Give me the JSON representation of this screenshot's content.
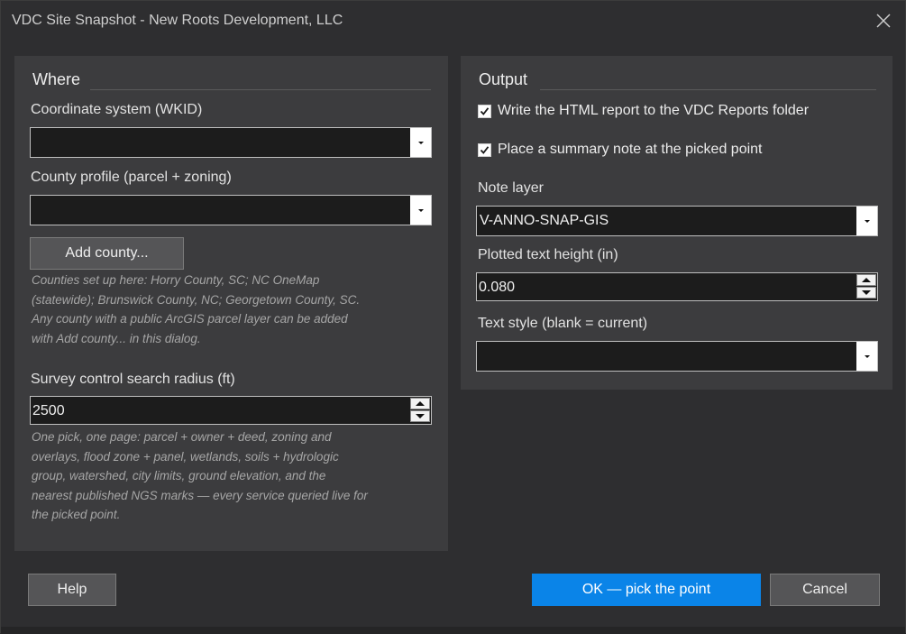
{
  "window": {
    "title": "VDC Site Snapshot - New Roots Development, LLC",
    "close_icon": "close-icon"
  },
  "where": {
    "title": "Where",
    "coordinate_label": "Coordinate system (WKID)",
    "coordinate_value": "",
    "county_label": "County profile (parcel + zoning)",
    "county_value": "",
    "add_county_label": "Add county...",
    "counties_hint": [
      "Counties set up here: Horry County, SC; NC OneMap",
      "(statewide); Brunswick County, NC; Georgetown County, SC.",
      "Any county with a public ArcGIS parcel layer can be added",
      "with Add county... in this dialog."
    ],
    "radius_label": "Survey control search radius (ft)",
    "radius_value": "2500",
    "pick_hint": [
      "One pick, one page: parcel + owner + deed, zoning and",
      "overlays, flood zone + panel, wetlands, soils + hydrologic",
      "group, watershed, city limits, ground elevation, and the",
      "nearest published NGS marks — every service queried live for",
      "the picked point."
    ]
  },
  "output": {
    "title": "Output",
    "write_html_label": "Write the HTML report to the VDC Reports folder",
    "write_html_checked": true,
    "place_note_label": "Place a summary note at the picked point",
    "place_note_checked": true,
    "note_layer_label": "Note layer",
    "note_layer_value": "V-ANNO-SNAP-GIS",
    "text_height_label": "Plotted text height (in)",
    "text_height_value": "0.080",
    "text_style_label": "Text style (blank = current)",
    "text_style_value": ""
  },
  "footer": {
    "help_label": "Help",
    "ok_label": "OK — pick the point",
    "cancel_label": "Cancel"
  },
  "colors": {
    "accent": "#0a84e8",
    "background": "#2e2e30",
    "panel": "#3c3c3e"
  }
}
